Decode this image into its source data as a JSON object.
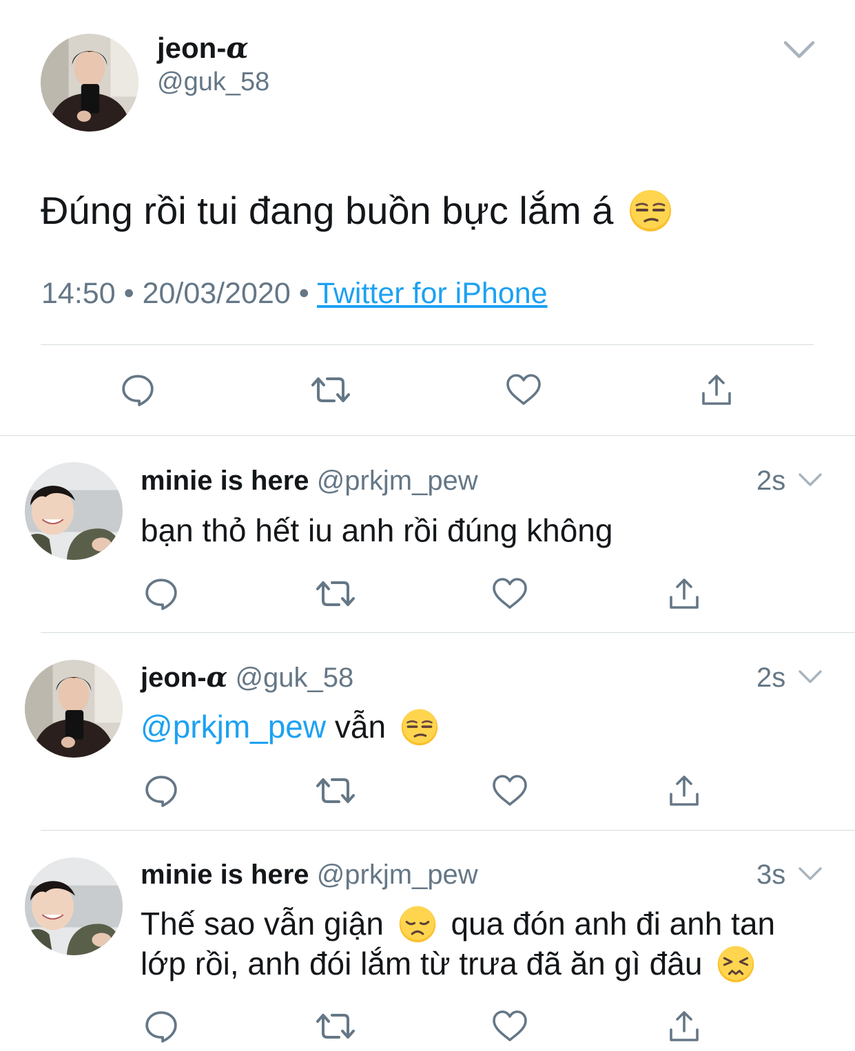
{
  "main_tweet": {
    "author_name": "jeon-",
    "author_alpha": "α",
    "author_handle": "@guk_58",
    "text": "Đúng rồi tui đang buồn bực lắm á",
    "emoji": "unamused-face",
    "time": "14:50",
    "sep1": "•",
    "date": "20/03/2020",
    "sep2": "•",
    "source": "Twitter for iPhone"
  },
  "replies": [
    {
      "author_name": "minie is here",
      "author_handle": "@prkjm_pew",
      "age": "2s",
      "text": "bạn thỏ hết iu anh rồi đúng không"
    },
    {
      "author_name": "jeon-",
      "author_alpha": "α",
      "author_handle": "@guk_58",
      "age": "2s",
      "mention": "@prkjm_pew",
      "text": "vẫn",
      "emoji": "unamused-face"
    },
    {
      "author_name": "minie is here",
      "author_handle": "@prkjm_pew",
      "age": "3s",
      "text_line1_a": "Thế sao vẫn giận",
      "emoji1": "disappointed-face",
      "text_line1_b": "qua đón anh đi anh tan",
      "text_line2": "lớp rồi, anh đói lắm từ trưa đã ăn gì đâu",
      "emoji2": "persevering-face"
    }
  ],
  "colors": {
    "link": "#1da1f2",
    "muted": "#657786",
    "icon": "#657786",
    "divider": "#d5dbe0"
  },
  "icons": [
    "chevron-down-icon",
    "reply-icon",
    "retweet-icon",
    "like-icon",
    "share-icon"
  ]
}
